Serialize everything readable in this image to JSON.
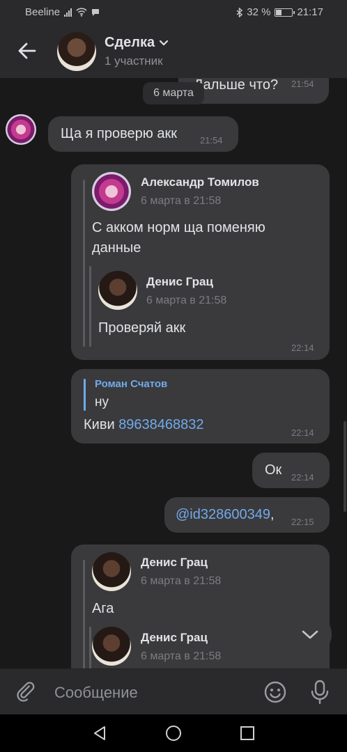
{
  "status": {
    "carrier": "Beeline",
    "battery": "32 %",
    "time": "21:17"
  },
  "header": {
    "title": "Сделка",
    "subtitle": "1 участник"
  },
  "date_separator": "6 марта",
  "messages": {
    "m0": {
      "text": "Дальше что?",
      "time": "21:54"
    },
    "m1": {
      "text": "Ща я проверю акк",
      "time": "21:54"
    },
    "m2": {
      "fwd1_name": "Александр Томилов",
      "fwd1_date": "6 марта в 21:58",
      "fwd1_text_l1": "С акком норм ща поменяю",
      "fwd1_text_l2": "данные",
      "fwd2_name": "Денис Грац",
      "fwd2_date": "6 марта в 21:58",
      "fwd2_text": "Проверяй акк",
      "time": "22:14"
    },
    "m3": {
      "reply_name": "Роман Счатов",
      "reply_text": "ну",
      "text_prefix": "Киви ",
      "phone": "89638468832",
      "time": "22:14"
    },
    "m4": {
      "text": "Ок",
      "time": "22:14"
    },
    "m5": {
      "mention": "@id328600349",
      "suffix": ",",
      "time": "22:15"
    },
    "m6": {
      "fwd1_name": "Денис Грац",
      "fwd1_date": "6 марта в 21:58",
      "fwd1_text": "Ага",
      "fwd2_name": "Денис Грац",
      "fwd2_date": "6 марта в 21:58"
    }
  },
  "composer": {
    "placeholder": "Сообщение"
  },
  "colors": {
    "background": "#19191a",
    "bubble": "#3a3a3c",
    "link": "#71aaeb",
    "header": "#2a2a2c"
  }
}
